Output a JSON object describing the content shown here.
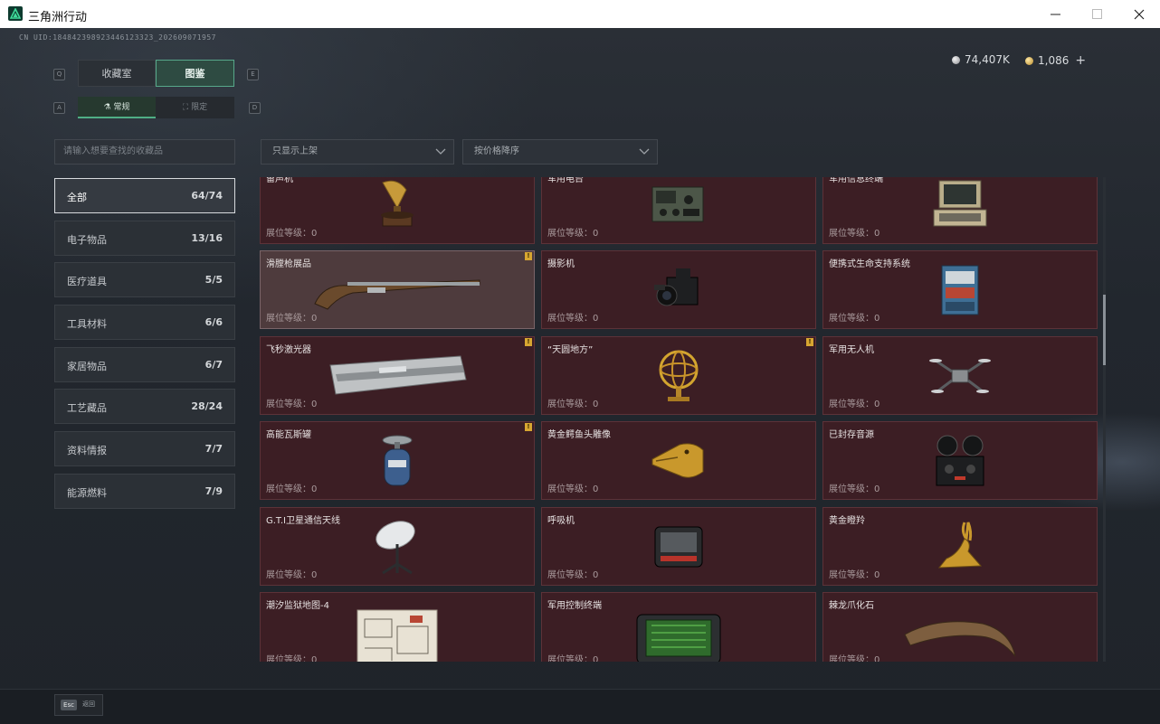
{
  "window": {
    "title": "三角洲行动"
  },
  "uid": "CN UID:184842398923446123323_202609071957",
  "tabs": [
    {
      "label": "收藏室",
      "key": "Q"
    },
    {
      "label": "图鉴",
      "key": "E"
    }
  ],
  "subtabs": [
    {
      "label": "常规",
      "key": "A"
    },
    {
      "label": "限定",
      "key": "D"
    }
  ],
  "currency": {
    "silver": "74,407K",
    "gold": "1,086",
    "plus": "+"
  },
  "search": {
    "placeholder": "请输入想要查找的收藏品"
  },
  "filters": {
    "shelf": "只显示上架",
    "sort": "按价格降序"
  },
  "categories": [
    {
      "name": "全部",
      "count": "64/74",
      "active": true
    },
    {
      "name": "电子物品",
      "count": "13/16"
    },
    {
      "name": "医疗道具",
      "count": "5/5"
    },
    {
      "name": "工具材料",
      "count": "6/6"
    },
    {
      "name": "家居物品",
      "count": "6/7"
    },
    {
      "name": "工艺藏品",
      "count": "28/24"
    },
    {
      "name": "资料情报",
      "count": "7/7"
    },
    {
      "name": "能源燃料",
      "count": "7/9"
    }
  ],
  "level_label": "展位等级：0",
  "items": [
    {
      "name": "留声机",
      "icon": "gramophone-icon",
      "badge": false
    },
    {
      "name": "军用电台",
      "icon": "radio-icon",
      "badge": false
    },
    {
      "name": "军用信息终端",
      "icon": "terminal-case-icon",
      "badge": false
    },
    {
      "name": "滑膛枪展品",
      "icon": "musket-icon",
      "badge": true,
      "selected": true
    },
    {
      "name": "摄影机",
      "icon": "camera-icon",
      "badge": false
    },
    {
      "name": "便携式生命支持系统",
      "icon": "life-support-icon",
      "badge": false
    },
    {
      "name": "飞秒激光器",
      "icon": "laser-case-icon",
      "badge": true
    },
    {
      "name": "“天圆地方”",
      "icon": "armillary-icon",
      "badge": true
    },
    {
      "name": "军用无人机",
      "icon": "drone-icon",
      "badge": false
    },
    {
      "name": "高能瓦斯罐",
      "icon": "gas-canister-icon",
      "badge": true
    },
    {
      "name": "黄金鳄鱼头雕像",
      "icon": "croc-head-icon",
      "badge": false
    },
    {
      "name": "已封存音源",
      "icon": "reel-recorder-icon",
      "badge": false
    },
    {
      "name": "G.T.I卫星通信天线",
      "icon": "satellite-dish-icon",
      "badge": false
    },
    {
      "name": "呼吸机",
      "icon": "ventilator-icon",
      "badge": false
    },
    {
      "name": "黄金瞪羚",
      "icon": "gazelle-icon",
      "badge": false
    },
    {
      "name": "潮汐监狱地图-4",
      "icon": "map-icon",
      "badge": false
    },
    {
      "name": "军用控制终端",
      "icon": "control-terminal-icon",
      "badge": false
    },
    {
      "name": "棘龙爪化石",
      "icon": "claw-fossil-icon",
      "badge": false
    }
  ],
  "badge_mark": "!",
  "footer": {
    "esc_key": "Esc",
    "back": "返回"
  },
  "colors": {
    "card_bg": "#3c1e24",
    "accent": "#4fae85",
    "badge": "#d7a631"
  }
}
